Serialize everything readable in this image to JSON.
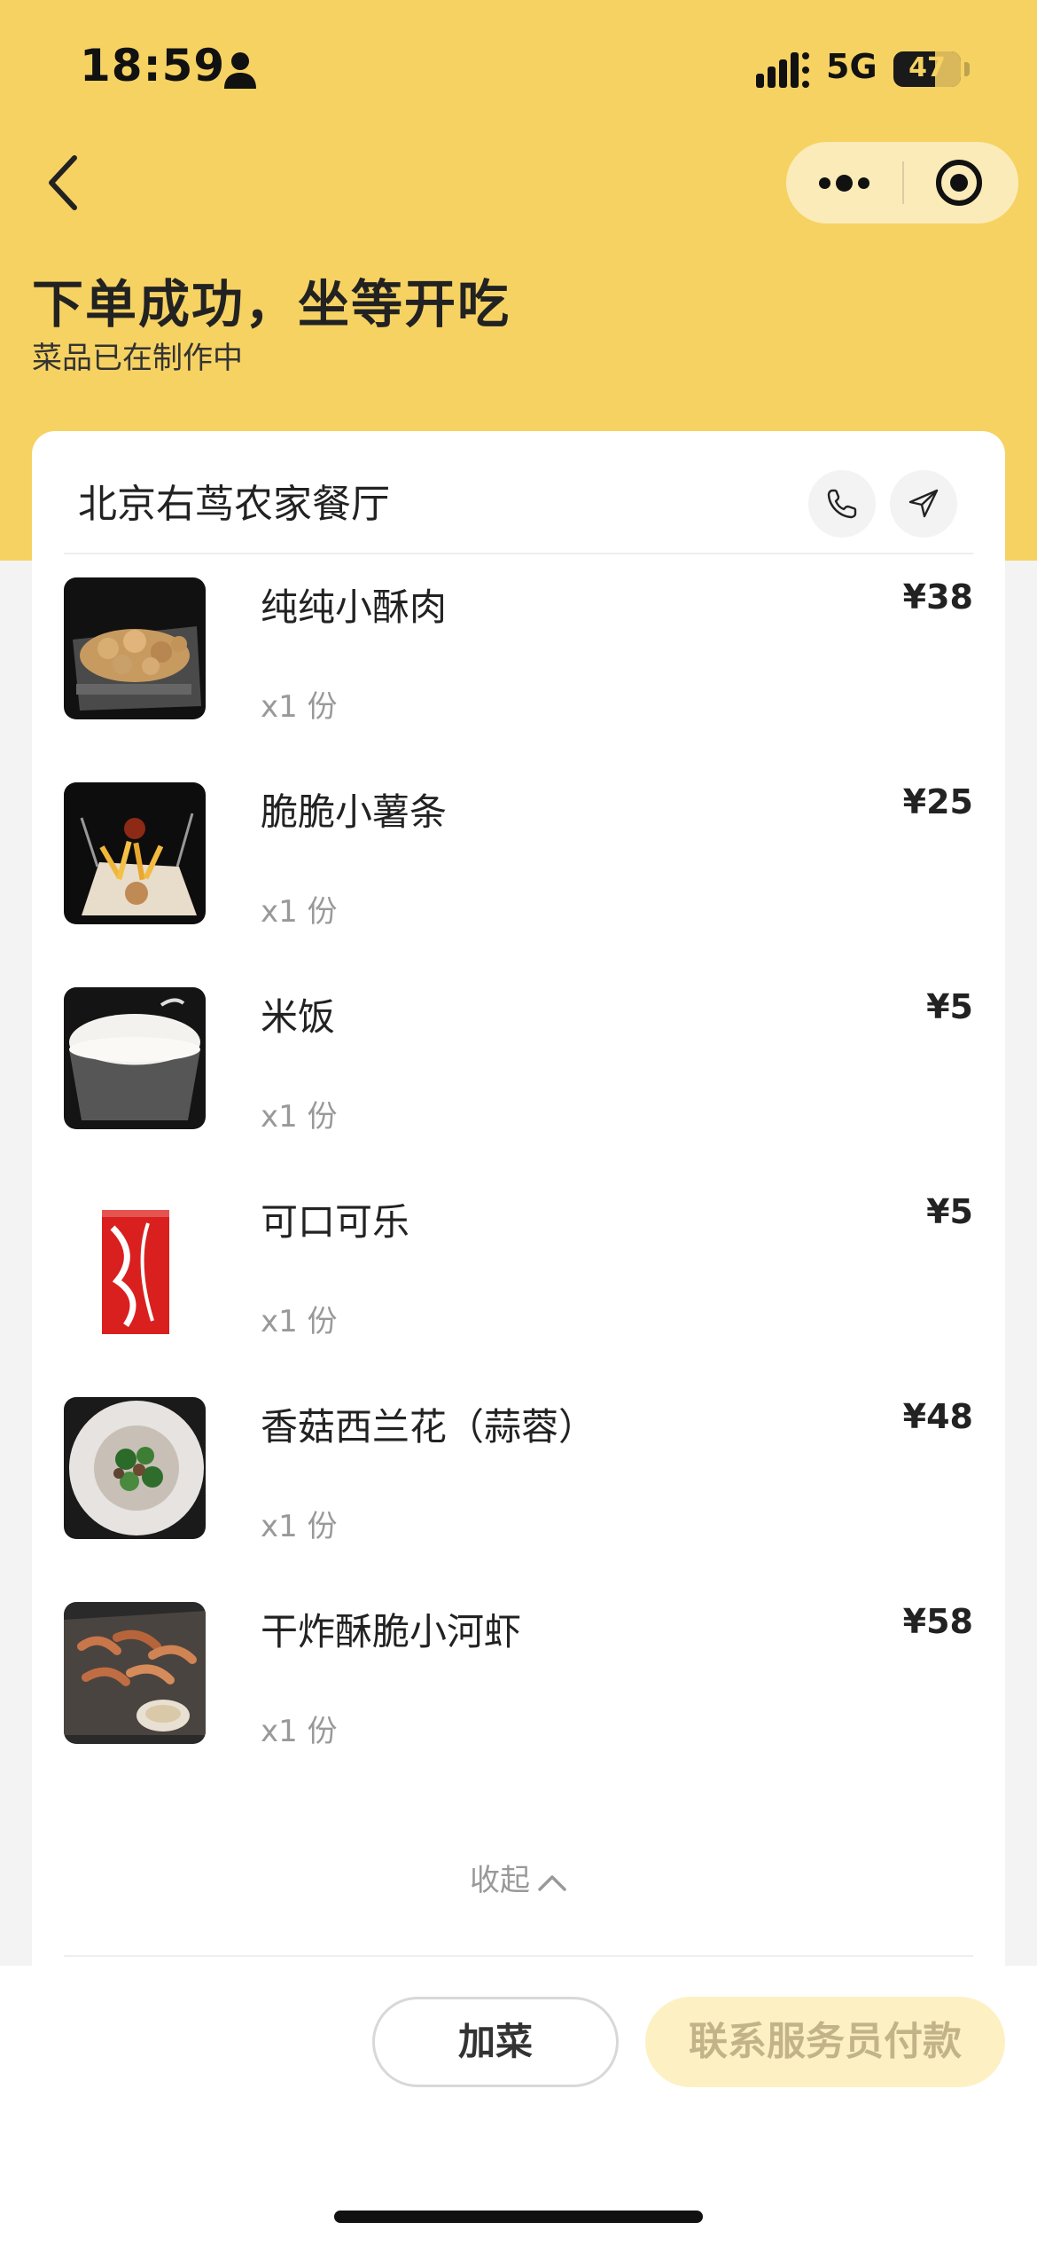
{
  "status_bar": {
    "time": "18:59",
    "network": "5G",
    "battery": "47"
  },
  "nav": {
    "back_icon": "chevron-left-icon",
    "more_icon": "more-dots-icon",
    "target_icon": "target-icon"
  },
  "header": {
    "title": "下单成功，坐等开吃",
    "subtitle": "菜品已在制作中"
  },
  "restaurant": {
    "name": "北京右茑农家餐厅",
    "phone_icon": "phone-icon",
    "nav_icon": "navigation-icon"
  },
  "items": [
    {
      "name": "纯纯小酥肉",
      "qty": "x1 份",
      "price": "¥38"
    },
    {
      "name": "脆脆小薯条",
      "qty": "x1 份",
      "price": "¥25"
    },
    {
      "name": "米饭",
      "qty": "x1 份",
      "price": "¥5"
    },
    {
      "name": "可口可乐",
      "qty": "x1 份",
      "price": "¥5"
    },
    {
      "name": "香菇西兰花（蒜蓉）",
      "qty": "x1 份",
      "price": "¥48"
    },
    {
      "name": "干炸酥脆小河虾",
      "qty": "x1 份",
      "price": "¥58"
    }
  ],
  "collapse_label": "收起",
  "actions": {
    "add_dish": "加菜",
    "pay": "联系服务员付款"
  },
  "colors": {
    "brand_yellow": "#f6d262",
    "pay_button_bg": "#fdf1c4",
    "pay_button_text": "#c2b488"
  }
}
